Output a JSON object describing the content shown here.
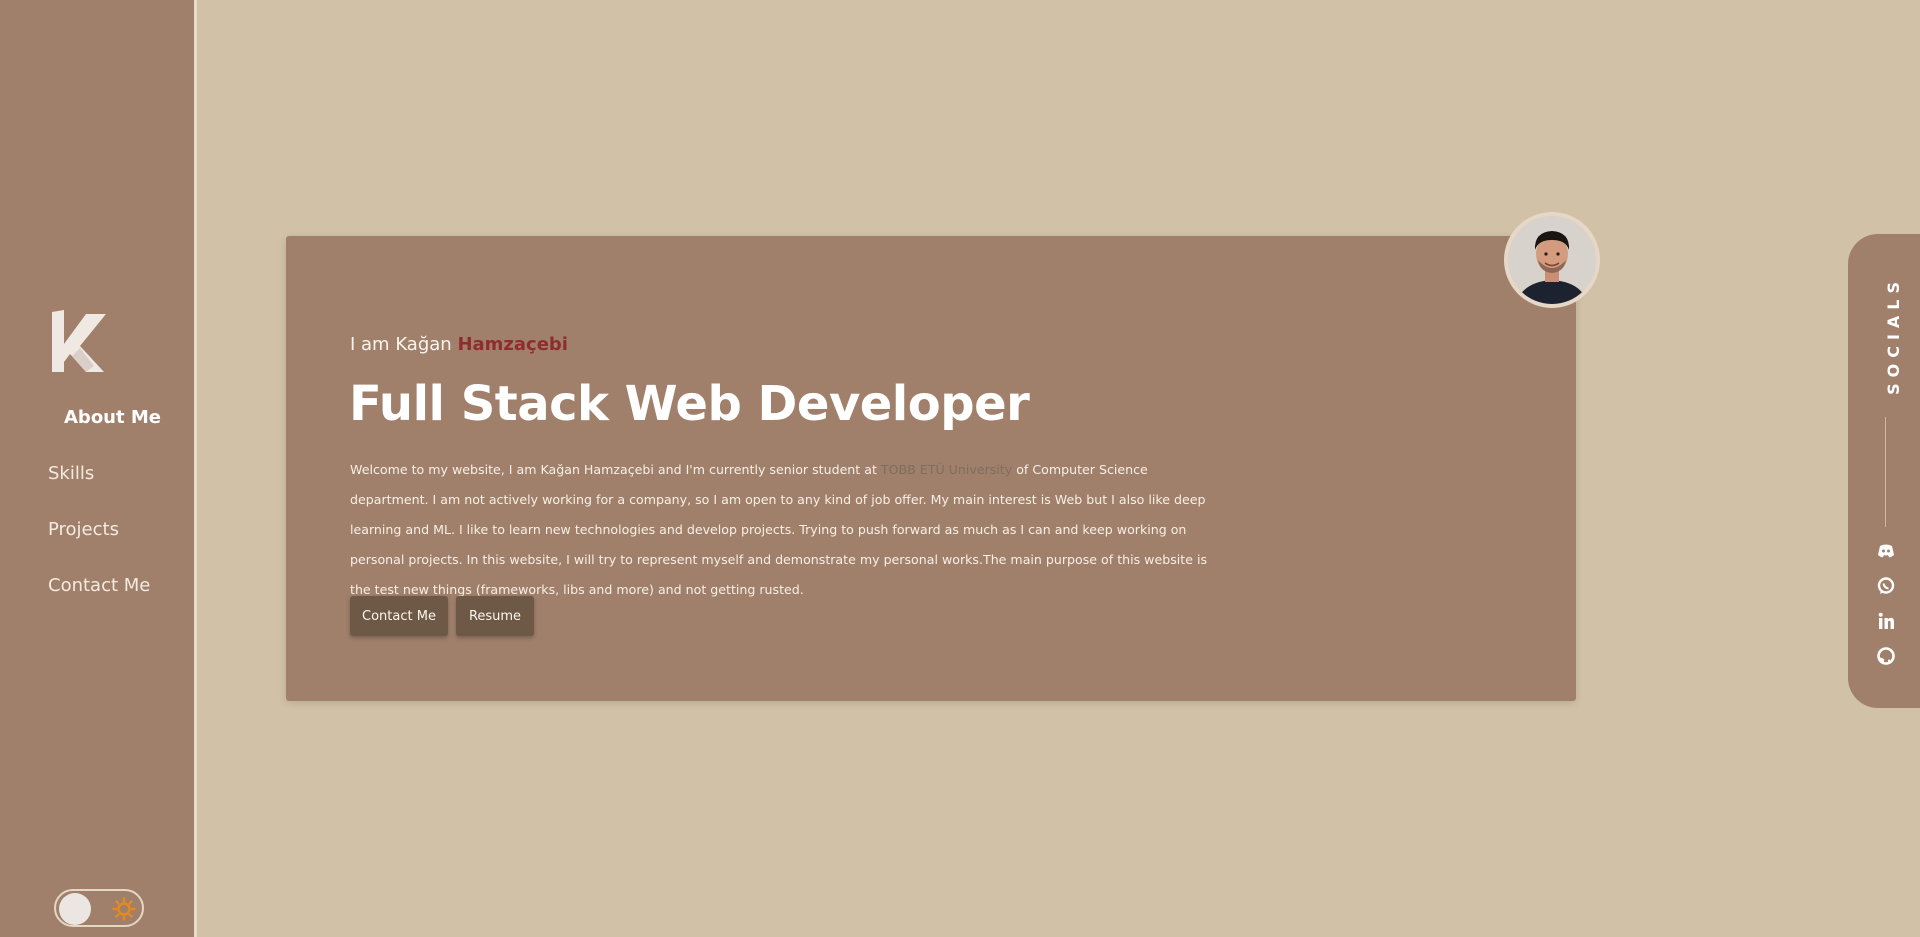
{
  "sidebar": {
    "logo_icon": "k-logo-icon",
    "nav": [
      {
        "label": "About Me",
        "active": true
      },
      {
        "label": "Skills",
        "active": false
      },
      {
        "label": "Projects",
        "active": false
      },
      {
        "label": "Contact Me",
        "active": false
      }
    ],
    "theme_toggle": {
      "icon": "sun-icon",
      "state": "light"
    }
  },
  "hero": {
    "intro_prefix": "I am Kağan",
    "intro_name": "Hamzaçebi",
    "headline": "Full Stack Web Developer",
    "description_before": "Welcome to my website, I am Kağan Hamzaçebi and I'm currently senior student at ",
    "university_link": "TOBB ETÜ University",
    "description_after": " of Computer Science department. I am not actively working for a company, so I am open to any kind of job offer. My main interest is Web but I also like deep learning and ML. I like to learn new technologies and develop projects. Trying to push forward as much as I can and keep working on personal projects. In this website, I will try to represent myself and demonstrate my personal works.The main purpose of this website is the test new things (frameworks, libs and more) and not getting rusted.",
    "buttons": {
      "contact": "Contact Me",
      "resume": "Resume"
    }
  },
  "socials": {
    "label": "SOCIALS",
    "icons": [
      "discord-icon",
      "whatsapp-icon",
      "linkedin-icon",
      "github-icon"
    ]
  },
  "colors": {
    "background": "#d1c1a7",
    "panel": "#a0806b",
    "accent_name": "#8f2d2d",
    "button": "#6e5846"
  }
}
